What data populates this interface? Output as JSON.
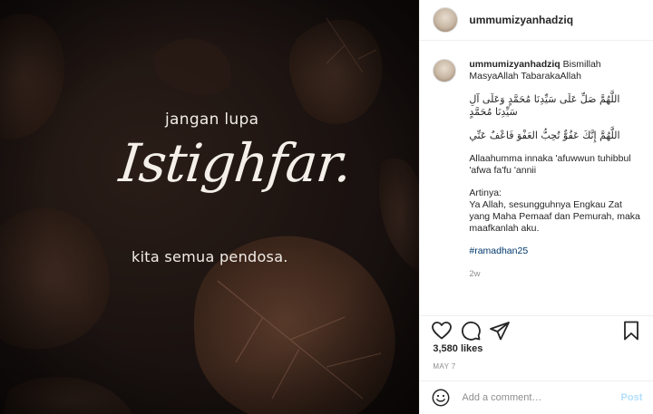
{
  "photo": {
    "line1": "jangan lupa",
    "line2": "Istighfar.",
    "line3": "kita semua pendosa."
  },
  "header": {
    "username": "ummumizyanhadziq"
  },
  "caption": {
    "username": "ummumizyanhadziq",
    "intro": "Bismillah MasyaAllah TabarakaAllah",
    "arabic1": "اللَّهُمَّ صَلِّ عَلَى سَيِّدِنَا مُحَمَّدٍ وَعَلَى آلِ سَيِّدِنَا مُحَمَّدٍ",
    "arabic2": "اللَّهُمَّ إِنَّكَ عَفُوٌّ تُحِبُّ العَفْوَ فَاعْفُ عَنِّي",
    "transliteration": "Allaahumma innaka 'afuwwun tuhibbul 'afwa fa'fu 'annii",
    "translation_title": "Artinya:",
    "translation": "Ya Allah, sesungguhnya Engkau Zat yang Maha Pemaaf dan Pemurah, maka maafkanlah aku.",
    "hashtag": "#ramadhan25",
    "time": "2w"
  },
  "actions": {
    "icons": [
      "heart-icon",
      "comment-icon",
      "share-icon",
      "bookmark-icon"
    ]
  },
  "likes": "3,580 likes",
  "date": "MAY 7",
  "add_comment": {
    "placeholder": "Add a comment…",
    "post_label": "Post"
  },
  "colors": {
    "link": "#00376b",
    "post_disabled": "#b2dffc",
    "muted": "#8e8e8e"
  }
}
